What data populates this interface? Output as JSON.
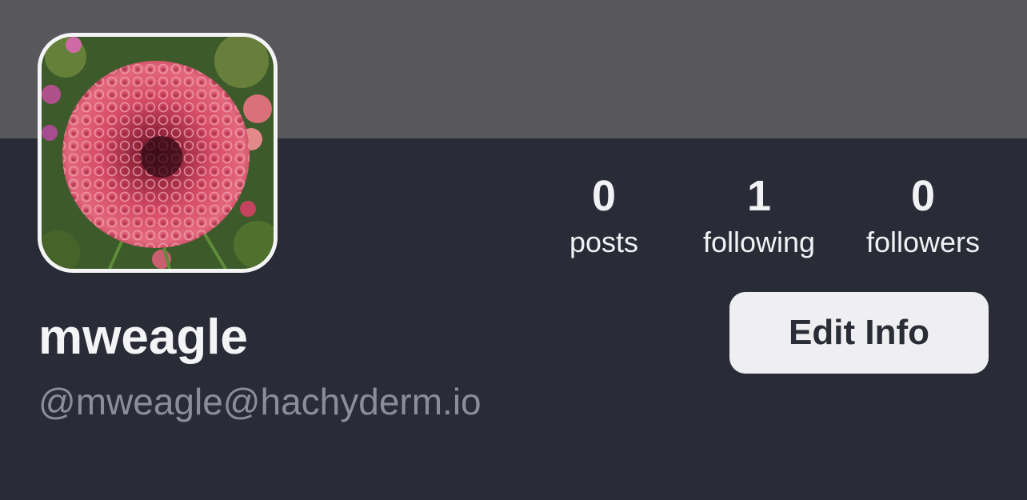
{
  "profile": {
    "display_name": "mweagle",
    "handle": "@mweagle@hachyderm.io",
    "avatar_icon": "dahlia-flower-photo"
  },
  "stats": {
    "posts": {
      "count": "0",
      "label": "posts"
    },
    "following": {
      "count": "1",
      "label": "following"
    },
    "followers": {
      "count": "0",
      "label": "followers"
    }
  },
  "actions": {
    "edit_label": "Edit Info"
  },
  "colors": {
    "banner": "#58585c",
    "background": "#292b37",
    "button_bg": "#efeff1",
    "handle_text": "#8b8d9b"
  }
}
